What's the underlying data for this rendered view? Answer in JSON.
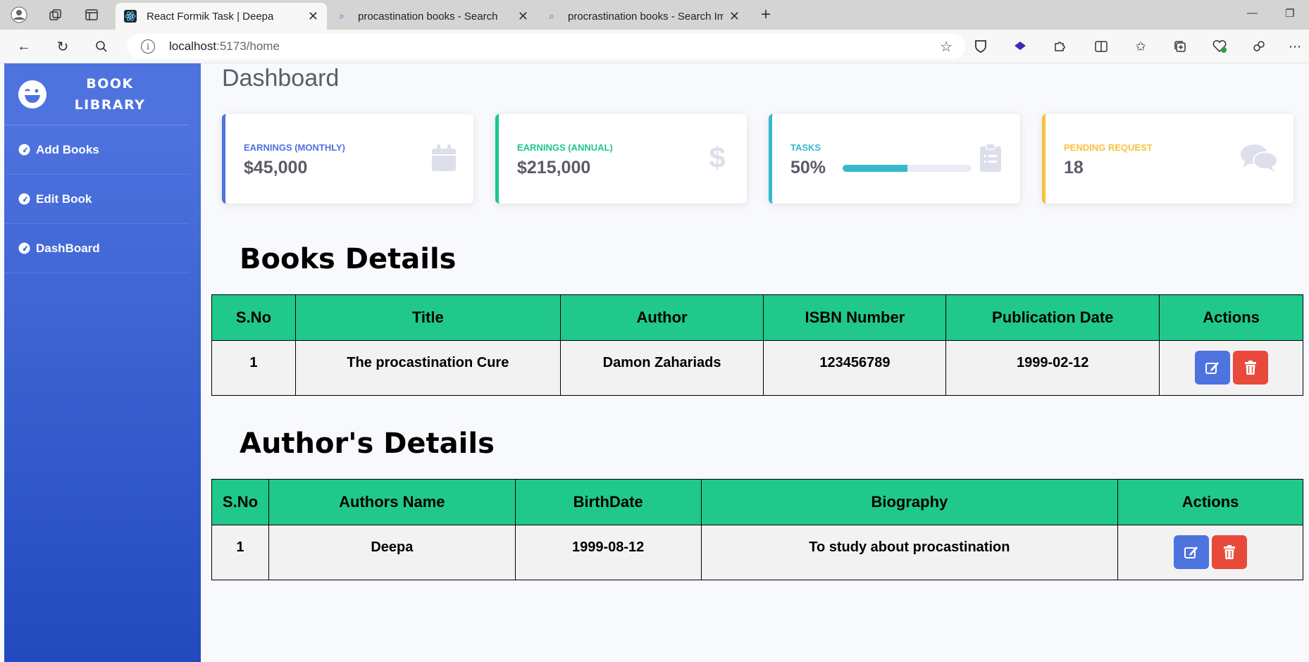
{
  "browser": {
    "tabs": [
      {
        "title": "React Formik Task | Deepa",
        "active": true
      },
      {
        "title": "procastination books - Search",
        "active": false
      },
      {
        "title": "procrastination books - Search Im",
        "active": false
      }
    ],
    "url_host": "localhost",
    "url_path": ":5173/home",
    "new_tab": "+",
    "close": "✕",
    "minimize": "—",
    "restore": "❐"
  },
  "sidebar": {
    "brand": "BOOK LIBRARY",
    "items": [
      {
        "label": "Add Books"
      },
      {
        "label": "Edit Book"
      },
      {
        "label": "DashBoard"
      }
    ]
  },
  "dashboard": {
    "title": "Dashboard",
    "cards": [
      {
        "label": "EARNINGS (MONTHLY)",
        "value": "$45,000",
        "color": "#4e73df",
        "icon": "calendar-icon"
      },
      {
        "label": "EARNINGS (ANNUAL)",
        "value": "$215,000",
        "color": "#1cc88a",
        "icon": "dollar-icon"
      },
      {
        "label": "TASKS",
        "value": "50%",
        "progress": 0.5,
        "color": "#36b9cc",
        "icon": "clipboard-icon"
      },
      {
        "label": "PENDING REQUEST",
        "value": "18",
        "color": "#f6c23e",
        "icon": "comments-icon"
      }
    ]
  },
  "books": {
    "heading": "Books Details",
    "columns": [
      "S.No",
      "Title",
      "Author",
      "ISBN Number",
      "Publication Date",
      "Actions"
    ],
    "rows": [
      [
        "1",
        "The procastination Cure",
        "Damon Zahariads",
        "123456789",
        "1999-02-12"
      ]
    ]
  },
  "authors": {
    "heading": "Author's Details",
    "columns": [
      "S.No",
      "Authors Name",
      "BirthDate",
      "Biography",
      "Actions"
    ],
    "rows": [
      [
        "1",
        "Deepa",
        "1999-08-12",
        "To study about procastination"
      ]
    ]
  },
  "colors": {
    "header_green": "#20c98b",
    "edit_blue": "#4e73df",
    "delete_red": "#e74a3b"
  }
}
